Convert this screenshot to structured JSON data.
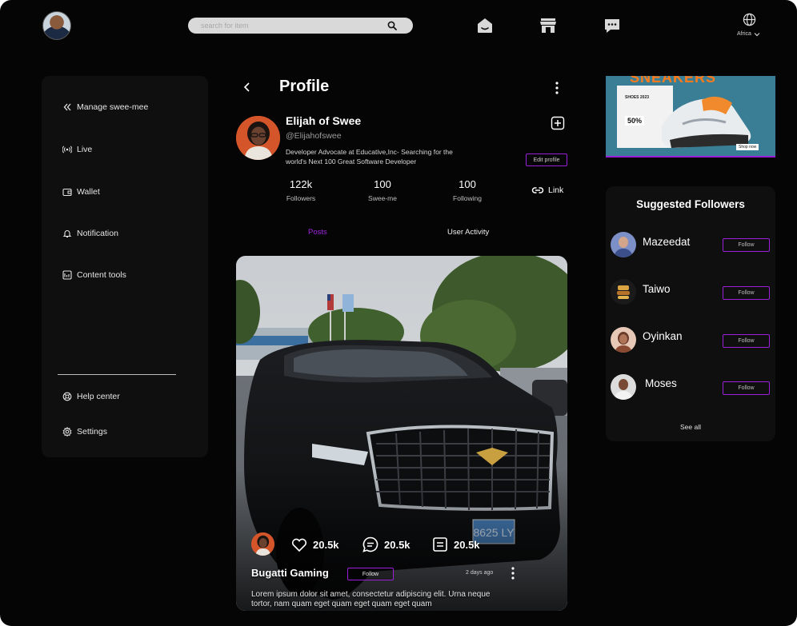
{
  "header": {
    "search_placeholder": "search for item",
    "region": "Africa"
  },
  "sidebar": {
    "items": [
      {
        "label": "Manage swee-mee",
        "icon": "double-chevron-left-icon"
      },
      {
        "label": "Live",
        "icon": "broadcast-icon"
      },
      {
        "label": "Wallet",
        "icon": "wallet-icon"
      },
      {
        "label": "Notification",
        "icon": "bell-icon"
      },
      {
        "label": "Content tools",
        "icon": "content-tools-icon"
      }
    ],
    "footer_items": [
      {
        "label": "Help center",
        "icon": "help-icon"
      },
      {
        "label": "Settings",
        "icon": "gear-icon"
      }
    ]
  },
  "profile": {
    "page_title": "Profile",
    "name": "Elijah of Swee",
    "handle": "@Elijahofswee",
    "bio": "Developer Advocate at Educative,Inc- Searching for the world's Next 100 Great Software Developer",
    "edit_label": "Edit profile",
    "stats": [
      {
        "value": "122k",
        "label": "Followers"
      },
      {
        "value": "100",
        "label": "Swee-me"
      },
      {
        "value": "100",
        "label": "Following"
      }
    ],
    "link_label": "Link",
    "tabs": [
      {
        "label": "Posts",
        "active": true
      },
      {
        "label": "User Activity",
        "active": false
      }
    ]
  },
  "post": {
    "reactions": [
      {
        "icon": "heart-icon",
        "count": "20.5k"
      },
      {
        "icon": "comment-icon",
        "count": "20.5k"
      },
      {
        "icon": "share-icon",
        "count": "20.5k"
      }
    ],
    "author": "Bugatti Gaming",
    "follow_label": "Follow",
    "time": "2 days ago",
    "caption": "Lorem ipsum dolor sit amet, consectetur adipiscing elit. Urna neque tortor, nam quam eget  quam eget quam eget quam"
  },
  "ad": {
    "title": "SNEAKERS",
    "subtitle": "SHOES 2023",
    "discount": "50%",
    "cta": "Shop now"
  },
  "suggested": {
    "title": "Suggested Followers",
    "follow_label": "Follow",
    "see_all": "See all",
    "people": [
      {
        "name": "Mazeedat"
      },
      {
        "name": "Taiwo"
      },
      {
        "name": "Oyinkan"
      },
      {
        "name": "Moses"
      }
    ]
  },
  "colors": {
    "accent": "#9b1fd9",
    "active_tab": "#a025e0",
    "background": "#050505",
    "panel": "#0f0f0f"
  }
}
